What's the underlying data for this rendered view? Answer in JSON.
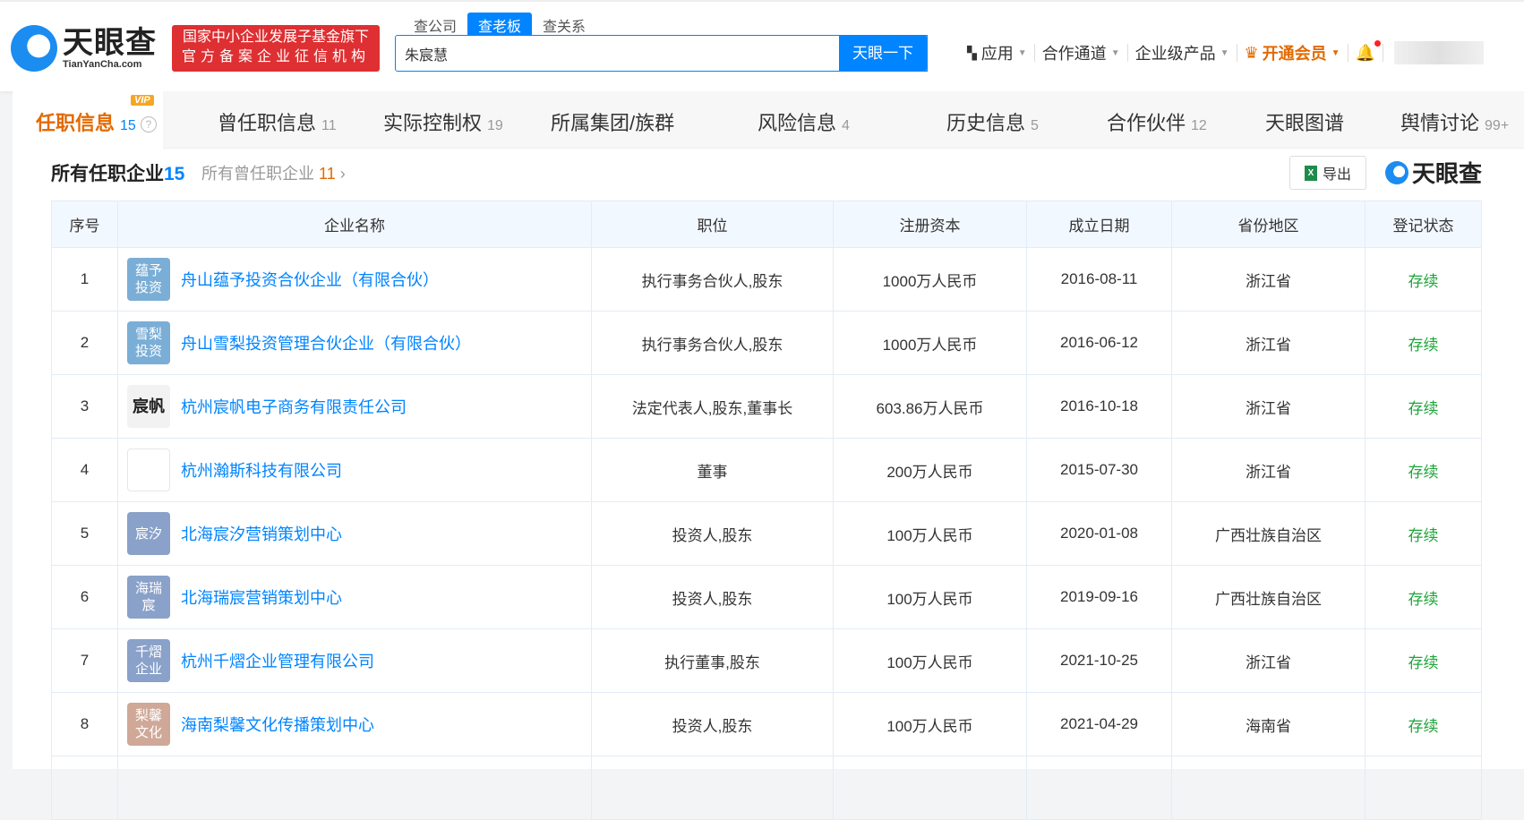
{
  "header": {
    "logo_cn": "天眼查",
    "logo_en": "TianYanCha.com",
    "badge_line1": "国家中小企业发展子基金旗下",
    "badge_line2": "官方备案企业征信机构",
    "search_tabs": [
      "查公司",
      "查老板",
      "查关系"
    ],
    "search_value": "朱宸慧",
    "search_button": "天眼一下",
    "nav": {
      "apps": "应用",
      "partner": "合作通道",
      "enterprise": "企业级产品",
      "vip": "开通会员"
    }
  },
  "tabs": [
    {
      "label": "任职信息",
      "count": "15",
      "badge": "VIP"
    },
    {
      "label": "曾任职信息",
      "count": "11"
    },
    {
      "label": "实际控制权",
      "count": "19"
    },
    {
      "label": "所属集团/族群",
      "count": ""
    },
    {
      "label": "风险信息",
      "count": "4"
    },
    {
      "label": "历史信息",
      "count": "5"
    },
    {
      "label": "合作伙伴",
      "count": "12"
    },
    {
      "label": "天眼图谱",
      "count": ""
    },
    {
      "label": "舆情讨论",
      "count": "99+"
    }
  ],
  "section": {
    "title": "所有任职企业",
    "count": "15",
    "former_label": "所有曾任职企业",
    "former_count": "11",
    "export": "导出",
    "watermark": "天眼查"
  },
  "table": {
    "headers": [
      "序号",
      "企业名称",
      "职位",
      "注册资本",
      "成立日期",
      "省份地区",
      "登记状态"
    ],
    "rows": [
      {
        "no": "1",
        "logo": "蕴予投资",
        "logo_color": "#7aaed6",
        "name": "舟山蕴予投资合伙企业（有限合伙）",
        "position": "执行事务合伙人,股东",
        "capital": "1000万人民币",
        "date": "2016-08-11",
        "province": "浙江省",
        "status": "存续"
      },
      {
        "no": "2",
        "logo": "雪梨投资",
        "logo_color": "#7aaed6",
        "name": "舟山雪梨投资管理合伙企业（有限合伙）",
        "position": "执行事务合伙人,股东",
        "capital": "1000万人民币",
        "date": "2016-06-12",
        "province": "浙江省",
        "status": "存续"
      },
      {
        "no": "3",
        "logo": "宸帆",
        "logo_color": "#f2f2f2",
        "name": "杭州宸帆电子商务有限责任公司",
        "position": "法定代表人,股东,董事长",
        "capital": "603.86万人民币",
        "date": "2016-10-18",
        "province": "浙江省",
        "status": "存续"
      },
      {
        "no": "4",
        "logo": "",
        "logo_color": "#ffffff",
        "name": "杭州瀚斯科技有限公司",
        "position": "董事",
        "capital": "200万人民币",
        "date": "2015-07-30",
        "province": "浙江省",
        "status": "存续"
      },
      {
        "no": "5",
        "logo": "宸汐",
        "logo_color": "#8aa1c9",
        "name": "北海宸汐营销策划中心",
        "position": "投资人,股东",
        "capital": "100万人民币",
        "date": "2020-01-08",
        "province": "广西壮族自治区",
        "status": "存续"
      },
      {
        "no": "6",
        "logo": "海瑞宸",
        "logo_color": "#8aa1c9",
        "name": "北海瑞宸营销策划中心",
        "position": "投资人,股东",
        "capital": "100万人民币",
        "date": "2019-09-16",
        "province": "广西壮族自治区",
        "status": "存续"
      },
      {
        "no": "7",
        "logo": "千熠企业",
        "logo_color": "#8aa1c9",
        "name": "杭州千熠企业管理有限公司",
        "position": "执行董事,股东",
        "capital": "100万人民币",
        "date": "2021-10-25",
        "province": "浙江省",
        "status": "存续"
      },
      {
        "no": "8",
        "logo": "梨馨文化",
        "logo_color": "#cfa898",
        "name": "海南梨馨文化传播策划中心",
        "position": "投资人,股东",
        "capital": "100万人民币",
        "date": "2021-04-29",
        "province": "海南省",
        "status": "存续"
      }
    ]
  }
}
